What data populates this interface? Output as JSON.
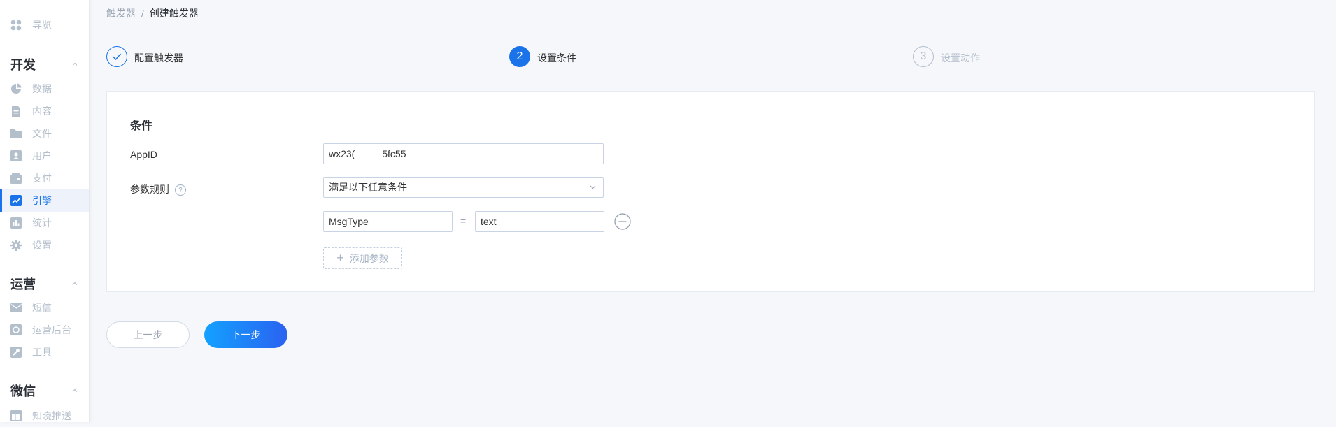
{
  "sidebar": {
    "top_item": {
      "label": "导览",
      "icon": "grid-icon"
    },
    "sections": [
      {
        "title": "开发",
        "items": [
          {
            "label": "数据",
            "icon": "pie-chart-icon"
          },
          {
            "label": "内容",
            "icon": "document-icon"
          },
          {
            "label": "文件",
            "icon": "folder-icon"
          },
          {
            "label": "用户",
            "icon": "user-card-icon"
          },
          {
            "label": "支付",
            "icon": "wallet-icon"
          },
          {
            "label": "引擎",
            "icon": "trend-icon",
            "active": true
          },
          {
            "label": "统计",
            "icon": "bar-chart-icon"
          },
          {
            "label": "设置",
            "icon": "gear-icon"
          }
        ]
      },
      {
        "title": "运营",
        "items": [
          {
            "label": "短信",
            "icon": "mail-icon"
          },
          {
            "label": "运营后台",
            "icon": "dashboard-icon"
          },
          {
            "label": "工具",
            "icon": "wrench-icon"
          }
        ]
      },
      {
        "title": "微信",
        "items": [
          {
            "label": "知晓推送",
            "icon": "layout-icon"
          }
        ]
      }
    ]
  },
  "breadcrumb": {
    "parent": "触发器",
    "separator": "/",
    "current": "创建触发器"
  },
  "steps": [
    {
      "label": "配置触发器",
      "state": "done",
      "icon": "check-icon"
    },
    {
      "label": "设置条件",
      "number": "2",
      "state": "active"
    },
    {
      "label": "设置动作",
      "number": "3",
      "state": "pending"
    }
  ],
  "form": {
    "title": "条件",
    "appid": {
      "label": "AppID",
      "value": "wx23(          5fc55"
    },
    "param_rule": {
      "label": "参数规则",
      "value": "满足以下任意条件"
    },
    "param_row": {
      "key": "MsgType",
      "operator": "=",
      "value": "text"
    },
    "add_param_label": "添加参数"
  },
  "buttons": {
    "prev": "上一步",
    "next": "下一步"
  },
  "colors": {
    "accent": "#1a73e8",
    "muted": "#b4bfcc"
  }
}
